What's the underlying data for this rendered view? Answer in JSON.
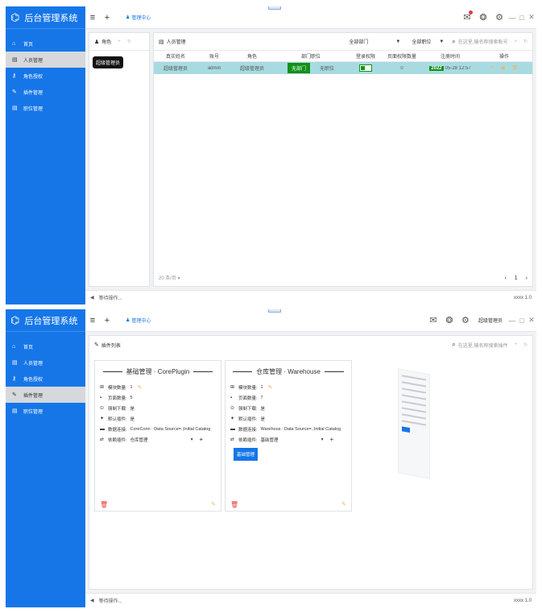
{
  "app": {
    "title": "后台管理系统",
    "version": "xxxx 1.0"
  },
  "sidebar": {
    "items": [
      {
        "label": "首页",
        "icon": "home-icon"
      },
      {
        "label": "人员管理",
        "icon": "id-card-icon"
      },
      {
        "label": "角色授权",
        "icon": "key-icon"
      },
      {
        "label": "插件管理",
        "icon": "wrench-icon"
      },
      {
        "label": "职位管理",
        "icon": "id-card-icon"
      }
    ]
  },
  "topbar": {
    "tab_label": "管理中心",
    "user_label": "超级管理员"
  },
  "status": {
    "text": "等待操作..."
  },
  "screen1": {
    "roles_title": "角色",
    "role_button": "超级管理员",
    "people_title": "人员管理",
    "dept_filter": "全部部门",
    "pos_filter": "全部职位",
    "search_placeholder": "在这里,输名称搜索账号",
    "columns": [
      "真实姓名",
      "账号",
      "角色",
      "部门职位",
      "登录权限",
      "页面权限数量",
      "注册时间",
      "操作"
    ],
    "row": {
      "name": "超级管理员",
      "account": "admin",
      "role": "超级管理员",
      "dept": "无部门",
      "position": "无职位",
      "perm_count": "0",
      "reg_year": "2022",
      "reg_rest": "05-28 12:57"
    },
    "page_size": "20 条/页",
    "page_current": "1"
  },
  "screen2": {
    "plugins_title": "插件列表",
    "search_placeholder": "在这里,输名称搜索插件",
    "cards": [
      {
        "title": "基础管理 · CorePlugin",
        "modules_label": "模块数量:",
        "modules": "1",
        "pages_label": "页面数量:",
        "pages": "5",
        "force_label": "强制下载:",
        "force": "是",
        "default_label": "默认插件:",
        "default": "是",
        "db_label": "数据连接:",
        "db": "CoreConn : Data Source=.;Initial Catalog",
        "dep_label": "依赖插件:",
        "dep": "仓库管理",
        "button": ""
      },
      {
        "title": "仓库管理 · Warehouse",
        "modules_label": "模块数量:",
        "modules": "1",
        "pages_label": "页面数量:",
        "pages": "7",
        "force_label": "强制下载:",
        "force": "是",
        "default_label": "默认插件:",
        "default": "是",
        "db_label": "数据连接:",
        "db": "Warehous : Data Source=.;Initial Catalog",
        "dep_label": "依赖插件:",
        "dep": "基础管理",
        "button": "基础管理"
      }
    ]
  }
}
